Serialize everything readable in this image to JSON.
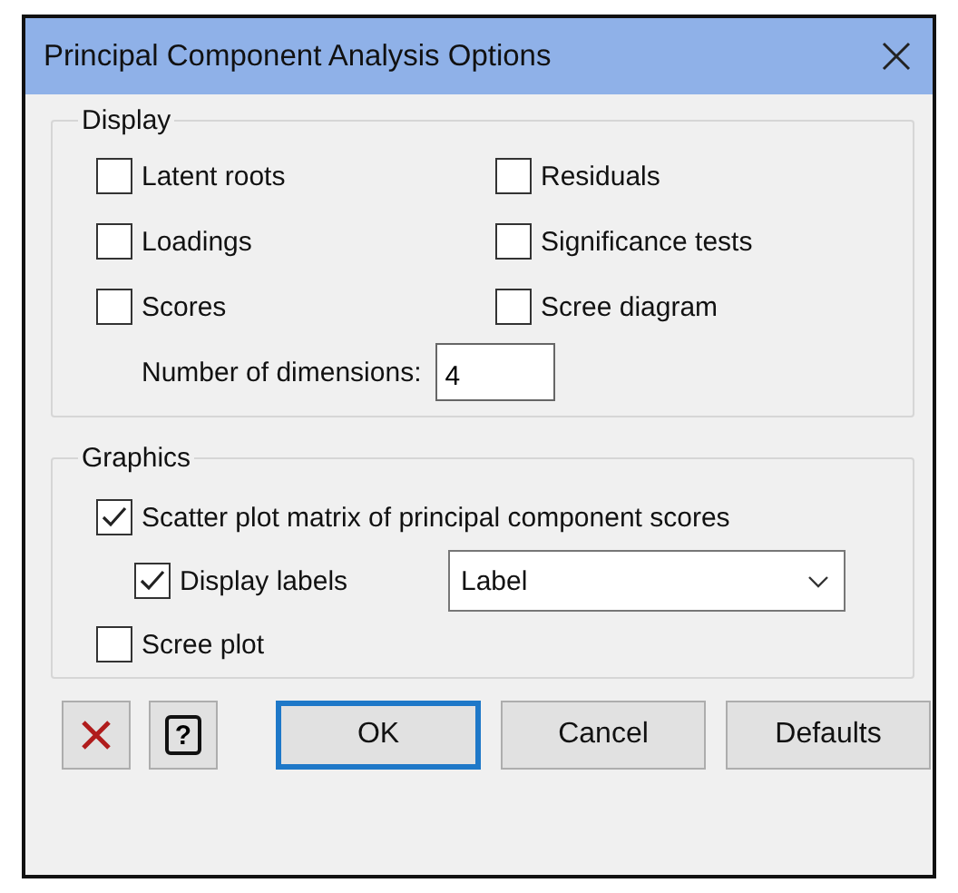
{
  "window": {
    "title": "Principal Component Analysis Options"
  },
  "display": {
    "title": "Display",
    "options": [
      {
        "label": "Latent roots",
        "checked": false
      },
      {
        "label": "Residuals",
        "checked": false
      },
      {
        "label": "Loadings",
        "checked": false
      },
      {
        "label": "Significance tests",
        "checked": false
      },
      {
        "label": "Scores",
        "checked": false
      },
      {
        "label": "Scree diagram",
        "checked": false
      }
    ],
    "dimensions": {
      "label": "Number of dimensions:",
      "value": "4"
    }
  },
  "graphics": {
    "title": "Graphics",
    "scatter": {
      "label": "Scatter plot matrix of principal component scores",
      "checked": true
    },
    "display_labels": {
      "label": "Display labels",
      "checked": true,
      "value": "Label"
    },
    "scree": {
      "label": "Scree plot",
      "checked": false
    }
  },
  "buttons": {
    "help": "?",
    "actions": [
      {
        "label": "OK",
        "selected": true
      },
      {
        "label": "Cancel",
        "selected": false
      },
      {
        "label": "Defaults",
        "selected": false
      }
    ]
  }
}
